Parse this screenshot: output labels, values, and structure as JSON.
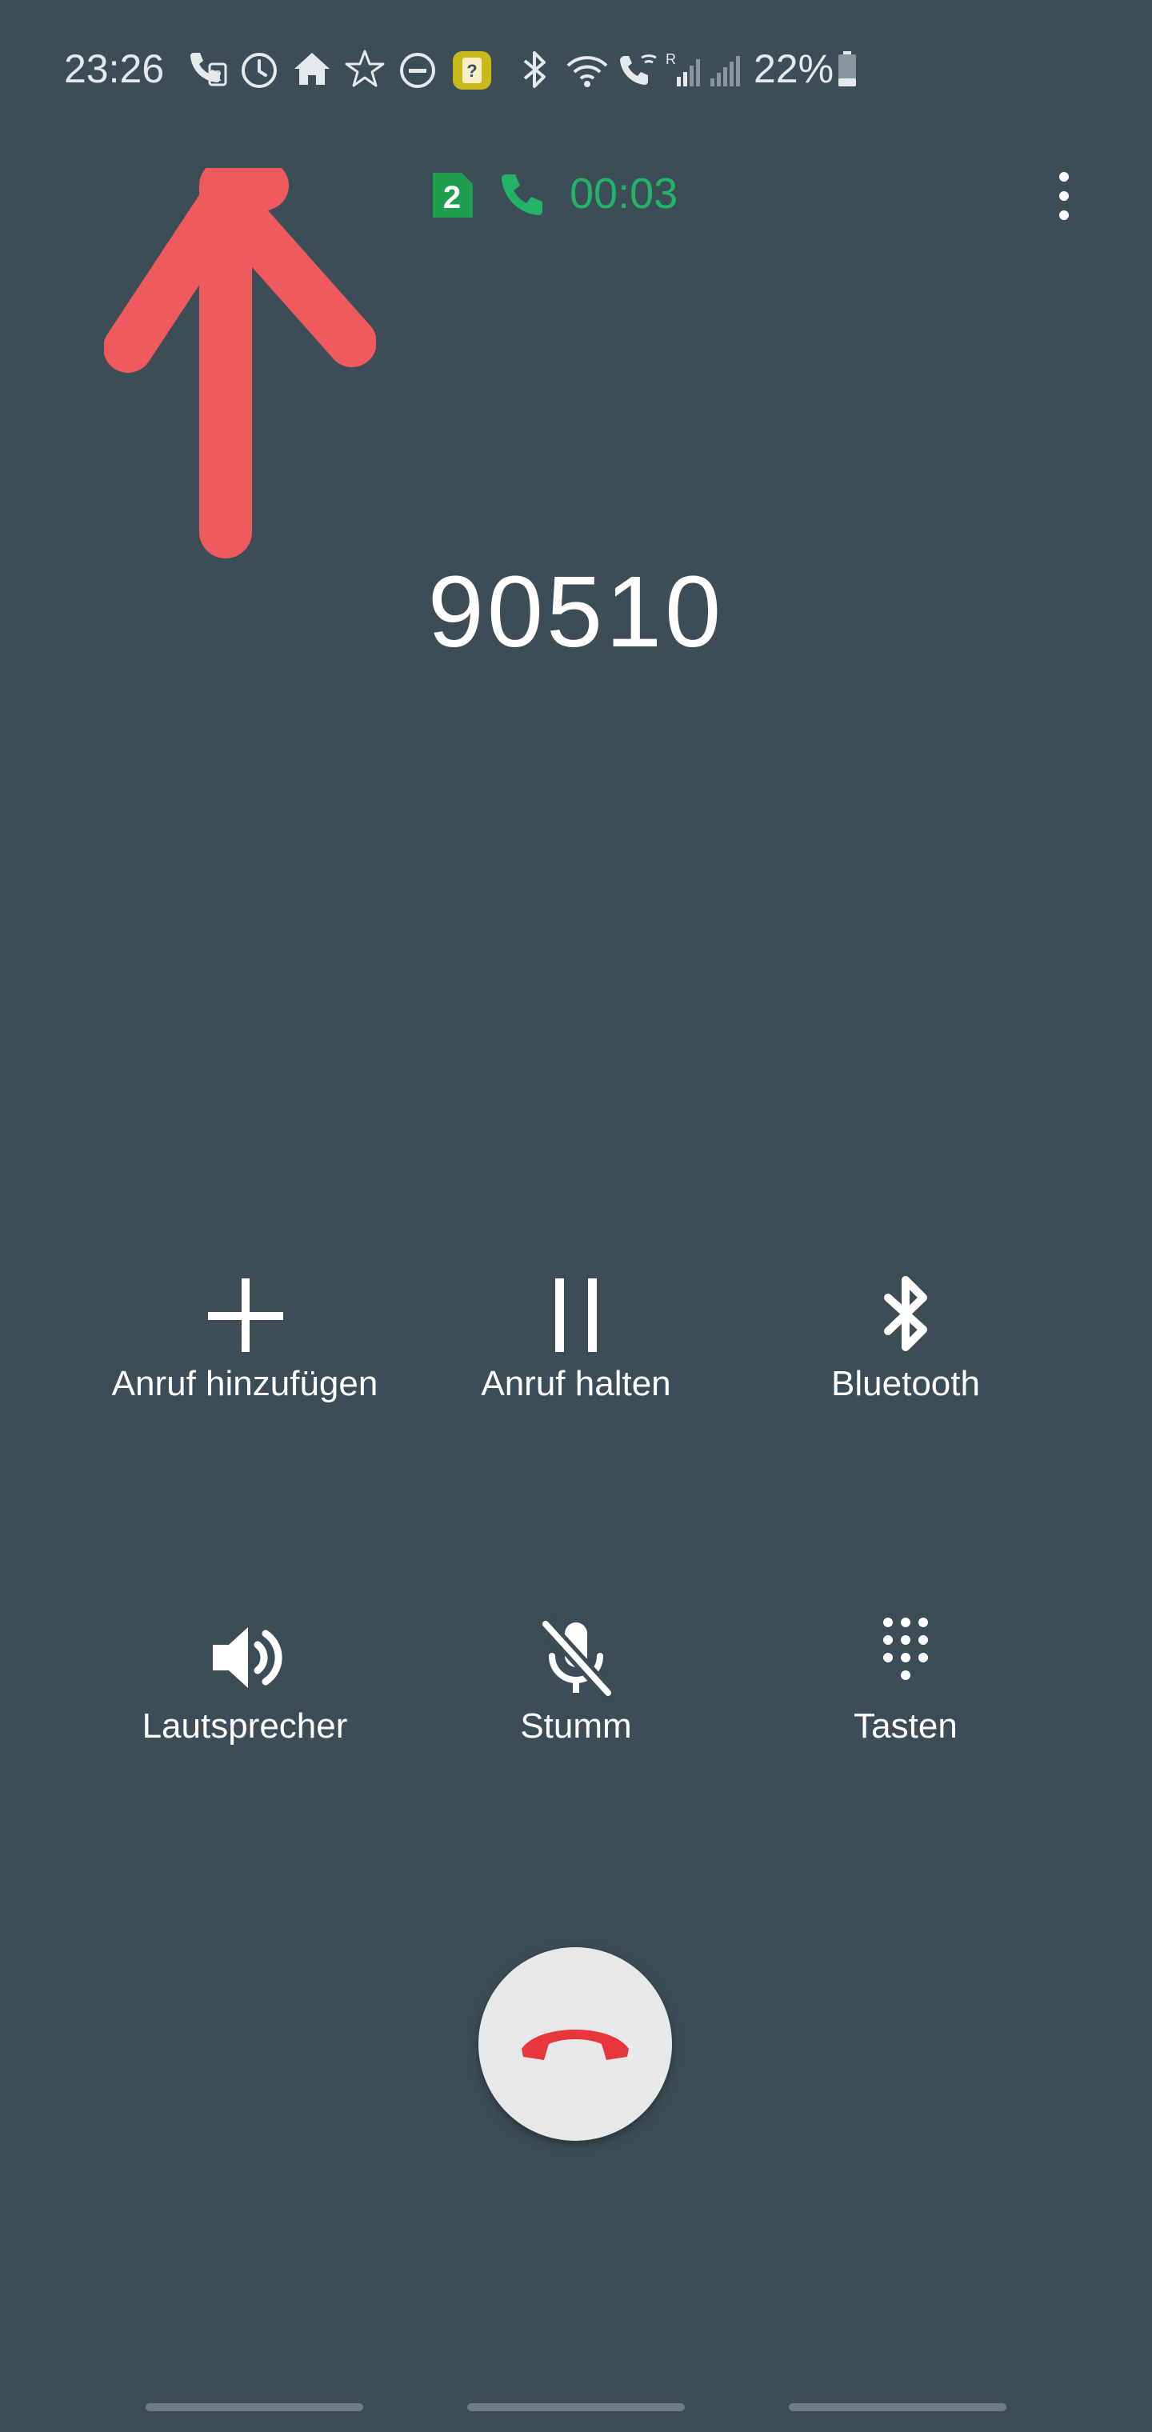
{
  "status_bar": {
    "time": "23:26",
    "battery_percent": "22%",
    "icons": [
      "call-sim2-icon",
      "alarm-icon",
      "home-icon",
      "star-icon",
      "do-not-disturb-icon",
      "sim-question-icon",
      "bluetooth-icon",
      "wifi-icon",
      "wifi-call-icon",
      "signal-roaming-icon",
      "signal-icon",
      "battery-icon"
    ],
    "roaming_label": "R"
  },
  "call_header": {
    "sim_number": "2",
    "timer": "00:03",
    "accent_color": "#22b466"
  },
  "caller": {
    "number": "90510"
  },
  "controls": {
    "add_call": "Anruf hinzufügen",
    "hold": "Anruf halten",
    "bluetooth": "Bluetooth",
    "speaker": "Lautsprecher",
    "mute": "Stumm",
    "keypad": "Tasten"
  },
  "end_call": {
    "icon": "end-call-icon",
    "color": "#e8363d"
  },
  "annotation": {
    "color": "#ee5a5e",
    "shape": "arrow-up"
  }
}
